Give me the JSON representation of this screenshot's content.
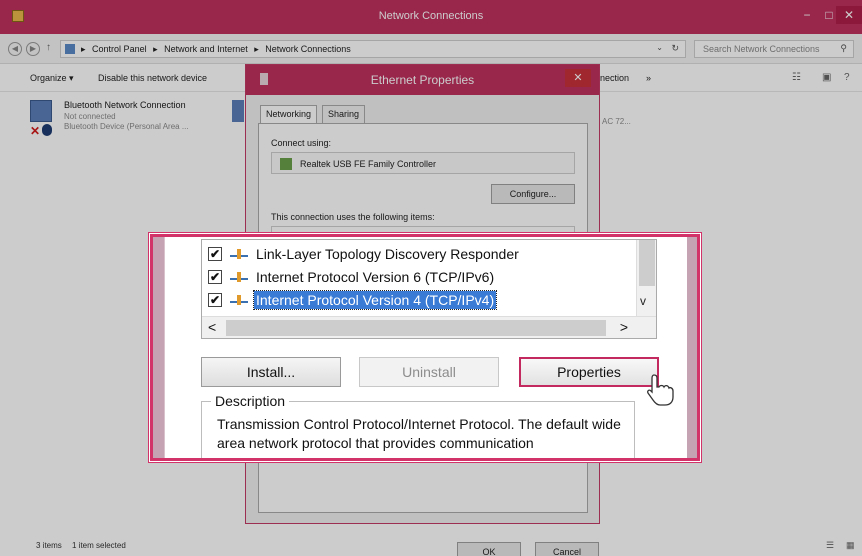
{
  "window": {
    "title": "Network Connections",
    "controls": {
      "minimize": "−",
      "maximize": "□",
      "close": "✕"
    }
  },
  "address_bar": {
    "crumbs": [
      "Control Panel",
      "Network and Internet",
      "Network Connections"
    ],
    "separator": "▸",
    "search_placeholder": "Search Network Connections"
  },
  "command_bar": {
    "organize": "Organize ▾",
    "disable": "Disable this network device",
    "more": "nection",
    "more_arrow": "»"
  },
  "connections": [
    {
      "name": "Bluetooth Network Connection",
      "status": "Not connected",
      "device": "Bluetooth Device (Personal Area ..."
    }
  ],
  "mac_fragment": "AC 72...",
  "status_bar": {
    "items": "3 items",
    "selected": "1 item selected"
  },
  "dialog": {
    "title": "Ethernet Properties",
    "close": "✕",
    "tabs": [
      "Networking",
      "Sharing"
    ],
    "connect_using_label": "Connect using:",
    "adapter": "Realtek USB FE Family Controller",
    "configure": "Configure...",
    "items_label": "This connection uses the following items:",
    "ok": "OK",
    "cancel": "Cancel"
  },
  "zoom": {
    "items": [
      {
        "label": "Link-Layer Topology Discovery Responder",
        "checked": true,
        "selected": false
      },
      {
        "label": "Internet Protocol Version 6 (TCP/IPv6)",
        "checked": true,
        "selected": false
      },
      {
        "label": "Internet Protocol Version 4 (TCP/IPv4)",
        "checked": true,
        "selected": true
      }
    ],
    "check_glyph": "✔",
    "scroll_left": "<",
    "scroll_right": ">",
    "scroll_down": "v",
    "install": "Install...",
    "uninstall": "Uninstall",
    "properties": "Properties",
    "description_title": "Description",
    "description_text": "Transmission Control Protocol/Internet Protocol. The default wide area network protocol that provides communication"
  },
  "colors": {
    "accent": "#c0305e",
    "callout_border": "#d2346a",
    "selection": "#3a7bd5"
  }
}
